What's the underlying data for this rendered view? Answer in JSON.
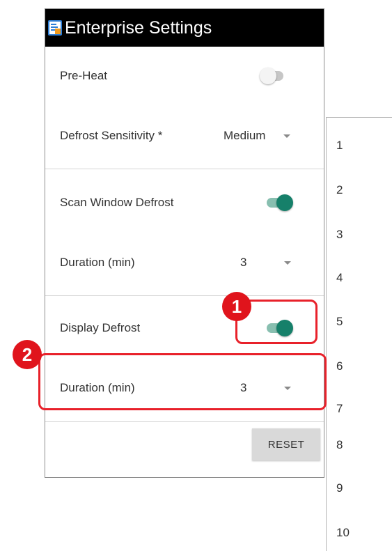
{
  "window": {
    "title": "Enterprise Settings",
    "icon": "app-settings-icon"
  },
  "settings": {
    "pre_heat": {
      "label": "Pre-Heat",
      "enabled": false
    },
    "defrost_sensitivity": {
      "label": "Defrost Sensitivity *",
      "value": "Medium"
    },
    "scan_window_defrost": {
      "label": "Scan Window Defrost",
      "enabled": true
    },
    "scan_duration": {
      "label": "Duration (min)",
      "value": "3"
    },
    "display_defrost": {
      "label": "Display Defrost",
      "enabled": true
    },
    "display_duration": {
      "label": "Duration (min)",
      "value": "3"
    }
  },
  "buttons": {
    "reset_label": "RESET"
  },
  "dropdown": {
    "options": [
      "1",
      "2",
      "3",
      "4",
      "5",
      "6",
      "7",
      "8",
      "9",
      "10"
    ]
  },
  "annotations": {
    "badge_1": "1",
    "badge_2": "2"
  },
  "colors": {
    "accent": "#16806a",
    "accent_track": "#88bfb0",
    "annotation_red": "#e8212a"
  }
}
